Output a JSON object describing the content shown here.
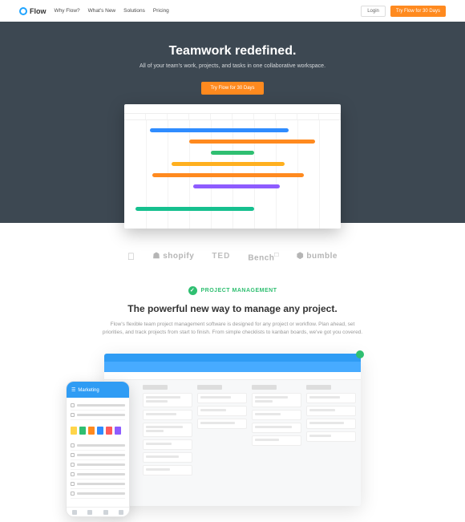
{
  "header": {
    "brand": "Flow",
    "nav": [
      "Why Flow?",
      "What's New",
      "Solutions",
      "Pricing"
    ],
    "login": "Login",
    "cta": "Try Flow for 30 Days"
  },
  "hero": {
    "title": "Teamwork redefined.",
    "subtitle": "All of your team's work, projects, and tasks in one collaborative workspace.",
    "cta": "Try Flow for 30 Days"
  },
  "logos": {
    "shopify": "shopify",
    "ted": "TED",
    "bench": "Bench",
    "bumble": "bumble"
  },
  "section": {
    "tag": "PROJECT MANAGEMENT",
    "title": "The powerful new way to manage any project.",
    "desc": "Flow's flexible team project management software is designed for any project or workflow. Plan ahead, set priorities, and track projects from start to finish. From simple checklists to kanban boards, we've got you covered."
  },
  "phone": {
    "header": "Marketing"
  }
}
